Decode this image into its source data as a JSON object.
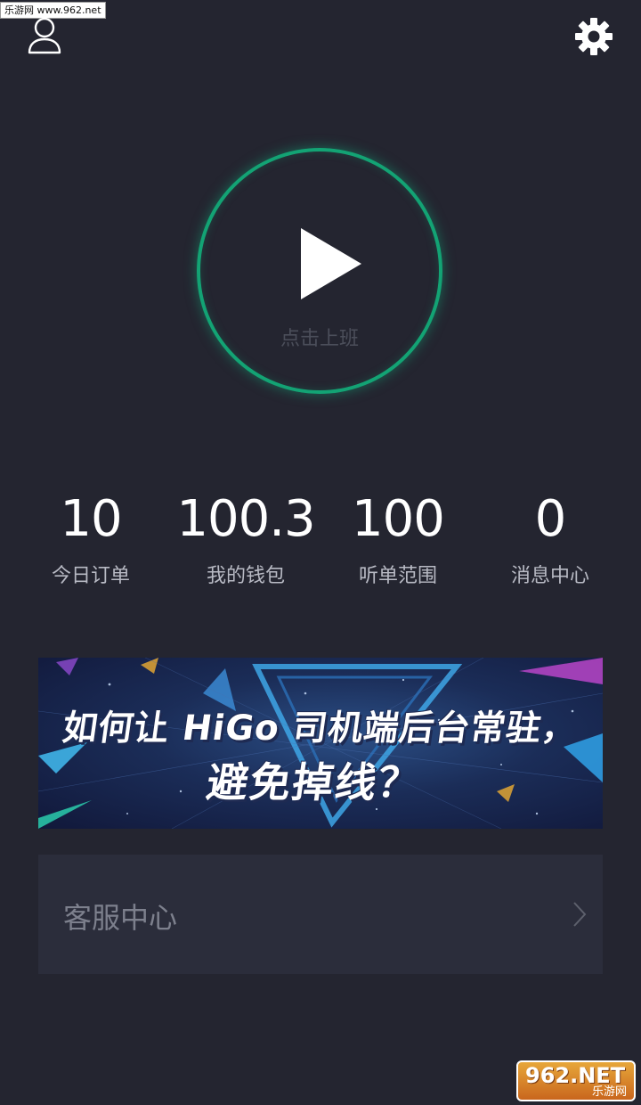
{
  "watermark": {
    "top_text": "乐游网 www.962.net",
    "bottom_big": "962.NET",
    "bottom_small": "乐游网"
  },
  "header": {
    "profile_icon": "user-icon",
    "settings_icon": "gear-icon"
  },
  "start": {
    "label": "点击上班",
    "icon": "play-icon",
    "accent": "#13a374"
  },
  "stats": [
    {
      "value": "10",
      "label": "今日订单"
    },
    {
      "value": "100.3",
      "label": "我的钱包"
    },
    {
      "value": "100",
      "label": "听单范围"
    },
    {
      "value": "0",
      "label": "消息中心"
    }
  ],
  "banner": {
    "line1": "如何让 HiGo 司机端后台常驻，",
    "line2": "避免掉线？"
  },
  "service": {
    "label": "客服中心",
    "icon": "chevron-right-icon"
  },
  "colors": {
    "background": "#242530",
    "card": "#2b2d3b"
  }
}
